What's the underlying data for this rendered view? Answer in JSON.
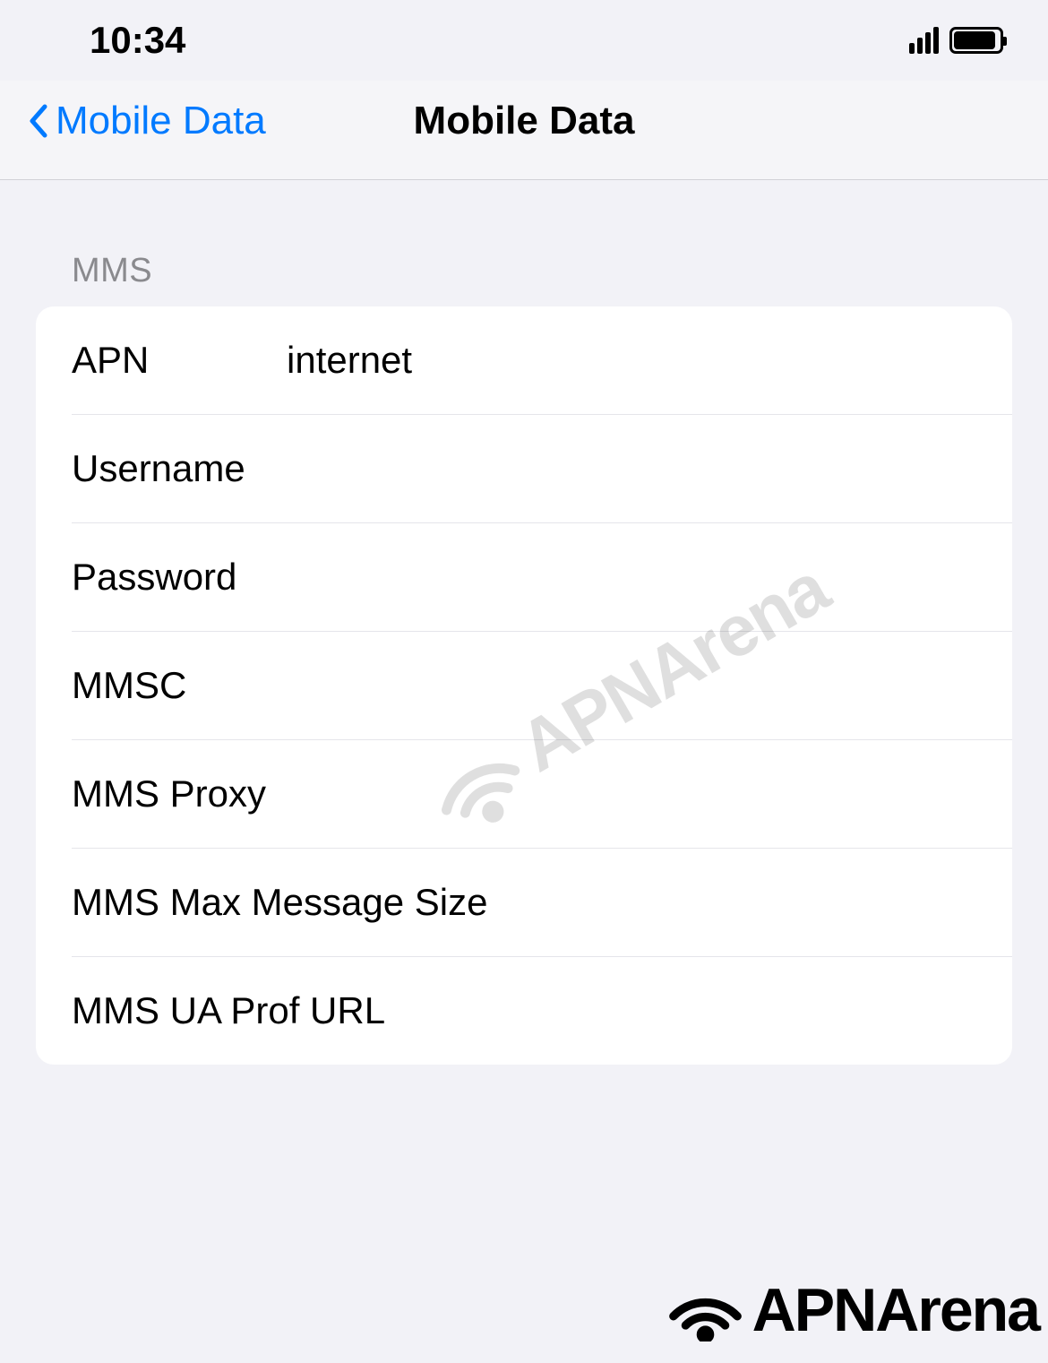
{
  "status": {
    "time": "10:34"
  },
  "nav": {
    "back_label": "Mobile Data",
    "title": "Mobile Data"
  },
  "section_header": "MMS",
  "fields": {
    "apn": {
      "label": "APN",
      "value": "internet"
    },
    "username": {
      "label": "Username",
      "value": ""
    },
    "password": {
      "label": "Password",
      "value": ""
    },
    "mmsc": {
      "label": "MMSC",
      "value": ""
    },
    "mms_proxy": {
      "label": "MMS Proxy",
      "value": ""
    },
    "mms_max_size": {
      "label": "MMS Max Message Size",
      "value": ""
    },
    "mms_ua_prof": {
      "label": "MMS UA Prof URL",
      "value": ""
    }
  },
  "watermark": "APNArena"
}
